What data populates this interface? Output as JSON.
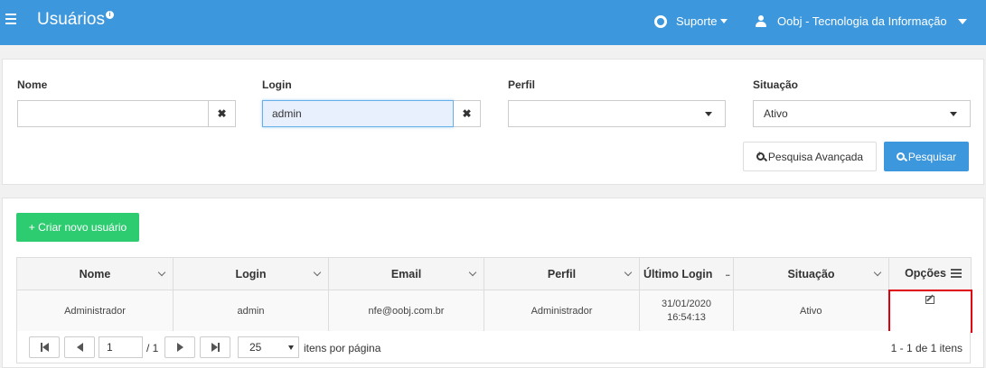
{
  "header": {
    "title": "Usuários",
    "title_badge": "i",
    "support_label": "Suporte",
    "company_label": "Oobj - Tecnologia da Informação"
  },
  "filters": {
    "nome_label": "Nome",
    "nome_value": "",
    "login_label": "Login",
    "login_value": "admin",
    "perfil_label": "Perfil",
    "perfil_value": "",
    "situacao_label": "Situação",
    "situacao_value": "Ativo",
    "clear_glyph": "✖",
    "advanced_search_label": "Pesquisa Avançada",
    "search_label": "Pesquisar"
  },
  "list": {
    "create_button_label": "+ Criar novo usuário",
    "columns": [
      "Nome",
      "Login",
      "Email",
      "Perfil",
      "Último Login",
      "Situação",
      "Opções"
    ],
    "rows": [
      {
        "nome": "Administrador",
        "login": "admin",
        "email": "nfe@oobj.com.br",
        "perfil": "Administrador",
        "ultimo_login_date": "31/01/2020",
        "ultimo_login_time": "16:54:13",
        "situacao": "Ativo"
      }
    ]
  },
  "pager": {
    "current_page": "1",
    "total_pages": "/ 1",
    "page_size": "25",
    "per_page_label": "itens por página",
    "summary": "1 - 1 de 1 itens"
  },
  "colors": {
    "header_bg": "#3c97dd",
    "primary": "#3c97dd",
    "success": "#2ecc71",
    "highlight_border": "#e0000d"
  }
}
